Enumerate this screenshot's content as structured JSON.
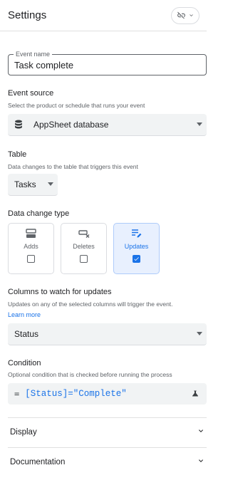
{
  "header": {
    "title": "Settings",
    "link_icon": "link-off-icon"
  },
  "event_name": {
    "label": "Event name",
    "value": "Task complete"
  },
  "event_source": {
    "title": "Event source",
    "description": "Select the product or schedule that runs your event",
    "value": "AppSheet database",
    "icon": "database-icon"
  },
  "table": {
    "title": "Table",
    "description": "Data changes to the table that triggers this event",
    "value": "Tasks"
  },
  "data_change_type": {
    "title": "Data change type",
    "options": [
      {
        "label": "Adds",
        "checked": false,
        "icon": "adds-icon"
      },
      {
        "label": "Deletes",
        "checked": false,
        "icon": "deletes-icon"
      },
      {
        "label": "Updates",
        "checked": true,
        "icon": "updates-icon"
      }
    ]
  },
  "columns_watch": {
    "title": "Columns to watch for updates",
    "description": "Updates on any of the selected columns will trigger the event.",
    "learn_more": "Learn more",
    "value": "Status"
  },
  "condition": {
    "title": "Condition",
    "description": "Optional condition that is checked before running the process",
    "operator": "=",
    "expression": "[Status]=\"Complete\"",
    "icon": "flask-icon"
  },
  "sections": [
    {
      "label": "Display"
    },
    {
      "label": "Documentation"
    }
  ],
  "colors": {
    "accent": "#1a73e8",
    "field_bg": "#f1f3f4",
    "selected_bg": "#e8f0fe"
  }
}
